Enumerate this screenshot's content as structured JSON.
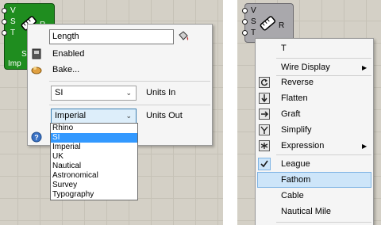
{
  "left_component": {
    "inputs": [
      "V",
      "S",
      "T"
    ],
    "output_initial": "R",
    "label_line1": "S",
    "label_line2": "Imp"
  },
  "left_menu": {
    "name_field": "Length",
    "enabled_label": "Enabled",
    "bake_label": "Bake...",
    "units_in_value": "SI",
    "units_in_label": "Units In",
    "units_out_value": "Imperial",
    "units_out_label": "Units Out",
    "options": [
      "Rhino",
      "SI",
      "Imperial",
      "UK",
      "Nautical",
      "Astronomical",
      "Survey",
      "Typography"
    ],
    "selected_option": "SI"
  },
  "right_component": {
    "inputs": [
      "V",
      "S",
      "T"
    ],
    "output": "R"
  },
  "right_menu": {
    "items": [
      {
        "label": "T",
        "icon": "",
        "submenu": false
      },
      {
        "label": "Wire Display",
        "icon": "",
        "submenu": true
      },
      {
        "label": "Reverse",
        "icon": "reverse-icon",
        "submenu": false
      },
      {
        "label": "Flatten",
        "icon": "flatten-icon",
        "submenu": false
      },
      {
        "label": "Graft",
        "icon": "graft-icon",
        "submenu": false
      },
      {
        "label": "Simplify",
        "icon": "simplify-icon",
        "submenu": false
      },
      {
        "label": "Expression",
        "icon": "expression-icon",
        "submenu": true
      },
      {
        "label": "League",
        "icon": "checkmark-icon",
        "submenu": false
      },
      {
        "label": "Fathom",
        "icon": "",
        "submenu": false
      },
      {
        "label": "Cable",
        "icon": "",
        "submenu": false
      },
      {
        "label": "Nautical Mile",
        "icon": "",
        "submenu": false
      }
    ],
    "checked_item": "League",
    "highlighted_item": "Fathom"
  },
  "colors": {
    "component_green": "#1f8d1f",
    "component_grey": "#a9a8ac",
    "selection_blue": "#3399ff",
    "hover_blue": "#cde5f9"
  }
}
